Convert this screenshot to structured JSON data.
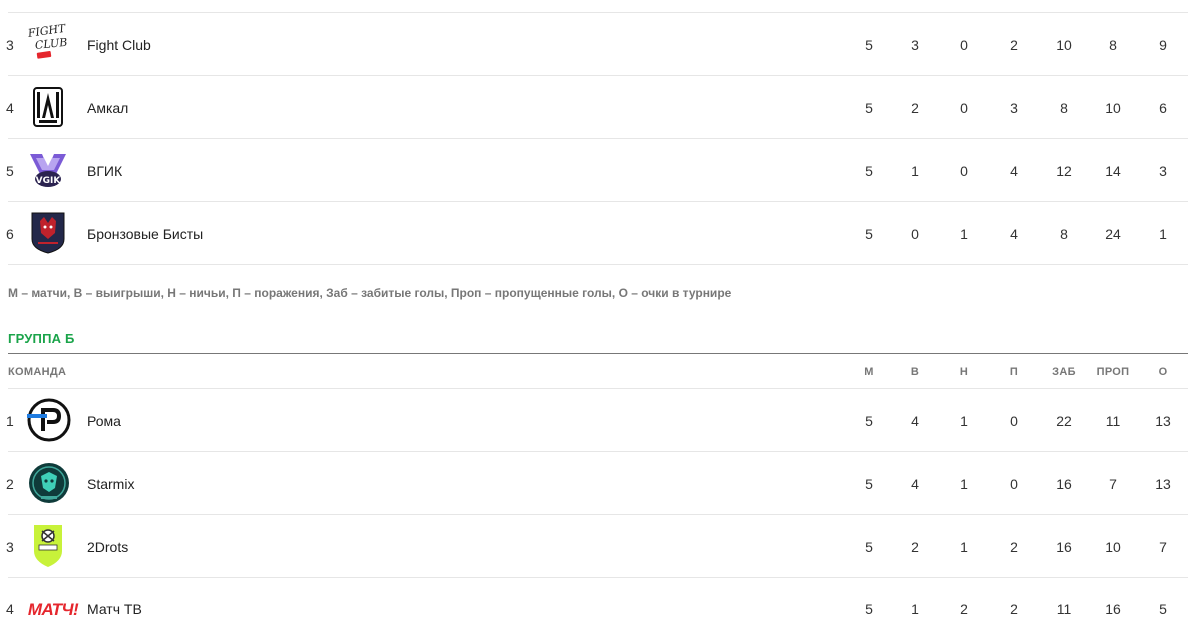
{
  "group_a_partial": {
    "rows": [
      {
        "rank": "3",
        "name": "Fight Club",
        "logo": "fight-club-logo",
        "m": "5",
        "w": "3",
        "d": "0",
        "l": "2",
        "gf": "10",
        "ga": "8",
        "pts": "9"
      },
      {
        "rank": "4",
        "name": "Амкал",
        "logo": "amkal-logo",
        "m": "5",
        "w": "2",
        "d": "0",
        "l": "3",
        "gf": "8",
        "ga": "10",
        "pts": "6"
      },
      {
        "rank": "5",
        "name": "ВГИК",
        "logo": "vgik-logo",
        "m": "5",
        "w": "1",
        "d": "0",
        "l": "4",
        "gf": "12",
        "ga": "14",
        "pts": "3"
      },
      {
        "rank": "6",
        "name": "Бронзовые Бисты",
        "logo": "bronze-beasts-logo",
        "m": "5",
        "w": "0",
        "d": "1",
        "l": "4",
        "gf": "8",
        "ga": "24",
        "pts": "1"
      }
    ]
  },
  "legend": "М – матчи, В – выигрыши, Н – ничьи, П – поражения, Заб – забитые голы, Проп – пропущенные голы, О – очки в турнире",
  "group_b": {
    "title": "ГРУППА Б",
    "headers": {
      "team": "КОМАНДА",
      "m": "М",
      "w": "В",
      "d": "Н",
      "l": "П",
      "gf": "ЗАБ",
      "ga": "ПРОП",
      "pts": "О"
    },
    "rows": [
      {
        "rank": "1",
        "name": "Рома",
        "logo": "roma-logo",
        "m": "5",
        "w": "4",
        "d": "1",
        "l": "0",
        "gf": "22",
        "ga": "11",
        "pts": "13"
      },
      {
        "rank": "2",
        "name": "Starmix",
        "logo": "starmix-logo",
        "m": "5",
        "w": "4",
        "d": "1",
        "l": "0",
        "gf": "16",
        "ga": "7",
        "pts": "13"
      },
      {
        "rank": "3",
        "name": "2Drots",
        "logo": "2drots-logo",
        "m": "5",
        "w": "2",
        "d": "1",
        "l": "2",
        "gf": "16",
        "ga": "10",
        "pts": "7"
      },
      {
        "rank": "4",
        "name": "Матч ТВ",
        "logo": "match-tv-logo",
        "logo_text": "МАТЧ!",
        "m": "5",
        "w": "1",
        "d": "2",
        "l": "2",
        "gf": "11",
        "ga": "16",
        "pts": "5"
      }
    ]
  },
  "colors": {
    "accent_green": "#1aa44a",
    "match_red": "#e5262d",
    "lime": "#c8f23a"
  }
}
